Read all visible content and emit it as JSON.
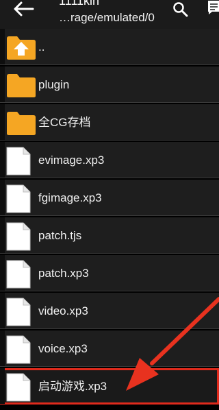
{
  "appbar": {
    "title": "1111kin",
    "path": "…rage/emulated/0",
    "icons": {
      "back": "back-arrow-icon",
      "search": "search-icon",
      "menu": "comment-icon"
    }
  },
  "files": [
    {
      "name": "..",
      "kind": "parent-folder"
    },
    {
      "name": "plugin",
      "kind": "folder"
    },
    {
      "name": "全CG存档",
      "kind": "folder"
    },
    {
      "name": "evimage.xp3",
      "kind": "file"
    },
    {
      "name": "fgimage.xp3",
      "kind": "file"
    },
    {
      "name": "patch.tjs",
      "kind": "file"
    },
    {
      "name": "patch.xp3",
      "kind": "file"
    },
    {
      "name": "video.xp3",
      "kind": "file"
    },
    {
      "name": "voice.xp3",
      "kind": "file"
    },
    {
      "name": "启动游戏.xp3",
      "kind": "file",
      "highlighted": true
    }
  ],
  "colors": {
    "folder": "#f5a623",
    "highlight": "#e02a1c",
    "row_bg": "#1e1e1e"
  }
}
